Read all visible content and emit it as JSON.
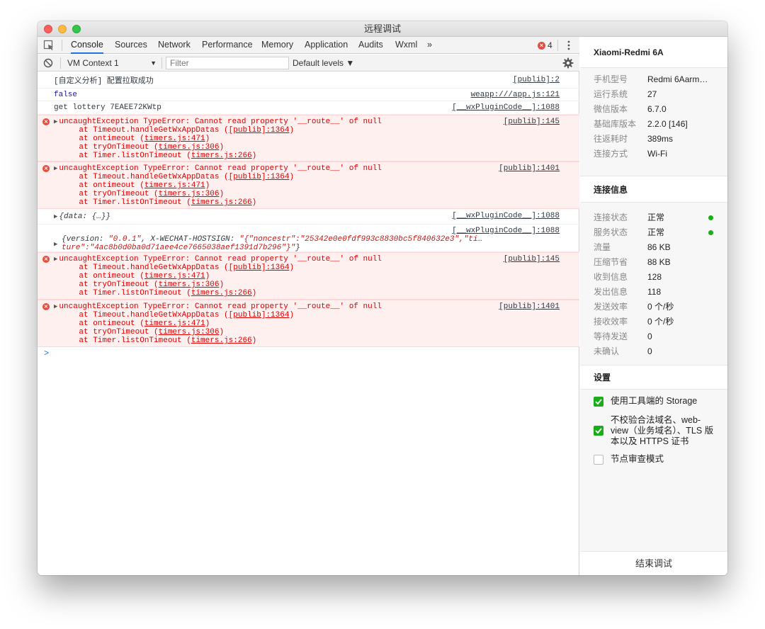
{
  "window": {
    "title": "远程调试"
  },
  "tabs": [
    {
      "label": "Console",
      "active": true
    },
    {
      "label": "Sources"
    },
    {
      "label": "Network"
    },
    {
      "label": "Performance"
    },
    {
      "label": "Memory"
    },
    {
      "label": "Application"
    },
    {
      "label": "Audits"
    },
    {
      "label": "Wxml"
    },
    {
      "label": "»"
    }
  ],
  "error_count": "4",
  "toolbar": {
    "context": "VM Context 1",
    "filter_placeholder": "Filter",
    "levels": "Default levels ▼"
  },
  "console": {
    "m1": {
      "text": "[自定义分析] 配置拉取成功",
      "src": "[publib]:2"
    },
    "m2": {
      "text": "false",
      "src": "weapp:///app.js:121"
    },
    "m3": {
      "text": "get lottery 7EAEE72KWtp",
      "src": "[__wxPluginCode__]:1088"
    },
    "e1": {
      "head": "uncaughtException TypeError: Cannot read property '__route__' of null",
      "src": "[publib]:145",
      "s1a": "    at Timeout.handleGetWxAppDatas (",
      "s1b": "[publib]:1364",
      "s1c": ")",
      "s2a": "    at ontimeout (",
      "s2b": "timers.js:471",
      "s2c": ")",
      "s3a": "    at tryOnTimeout (",
      "s3b": "timers.js:306",
      "s3c": ")",
      "s4a": "    at Timer.listOnTimeout (",
      "s4b": "timers.js:266",
      "s4c": ")"
    },
    "e2": {
      "head": "uncaughtException TypeError: Cannot read property '__route__' of null",
      "src": "[publib]:1401",
      "s1a": "    at Timeout.handleGetWxAppDatas (",
      "s1b": "[publib]:1364",
      "s1c": ")",
      "s2a": "    at ontimeout (",
      "s2b": "timers.js:471",
      "s2c": ")",
      "s3a": "    at tryOnTimeout (",
      "s3b": "timers.js:306",
      "s3c": ")",
      "s4a": "    at Timer.listOnTimeout (",
      "s4b": "timers.js:266",
      "s4c": ")"
    },
    "m4": {
      "text": "{data: {…}}",
      "src": "[__wxPluginCode__]:1088"
    },
    "m5": {
      "src": "[__wxPluginCode__]:1088",
      "l1a": "{version: ",
      "l1b": "\"0.0.1\"",
      "l1c": ", X-WECHAT-HOSTSIGN: ",
      "l1d": "\"{\"noncestr\":\"25342e0e0fdf993c8830bc5f840632e3\",\"ti…",
      "l2a": "ture\":\"4ac8b0d0ba0d71aee4ce7665038aef1391d7b296\"}\"",
      "l2b": "}"
    },
    "e3": {
      "head": "uncaughtException TypeError: Cannot read property '__route__' of null",
      "src": "[publib]:145",
      "s1a": "    at Timeout.handleGetWxAppDatas (",
      "s1b": "[publib]:1364",
      "s1c": ")",
      "s2a": "    at ontimeout (",
      "s2b": "timers.js:471",
      "s2c": ")",
      "s3a": "    at tryOnTimeout (",
      "s3b": "timers.js:306",
      "s3c": ")",
      "s4a": "    at Timer.listOnTimeout (",
      "s4b": "timers.js:266",
      "s4c": ")"
    },
    "e4": {
      "head": "uncaughtException TypeError: Cannot read property '__route__' of null",
      "src": "[publib]:1401",
      "s1a": "    at Timeout.handleGetWxAppDatas (",
      "s1b": "[publib]:1364",
      "s1c": ")",
      "s2a": "    at ontimeout (",
      "s2b": "timers.js:471",
      "s2c": ")",
      "s3a": "    at tryOnTimeout (",
      "s3b": "timers.js:306",
      "s3c": ")",
      "s4a": "    at Timer.listOnTimeout (",
      "s4b": "timers.js:266",
      "s4c": ")"
    },
    "prompt": ">"
  },
  "side": {
    "device": "Xiaomi-Redmi 6A",
    "info": [
      {
        "k": "手机型号",
        "v": "Redmi 6Aarme…"
      },
      {
        "k": "运行系统",
        "v": "27"
      },
      {
        "k": "微信版本",
        "v": "6.7.0"
      },
      {
        "k": "基础库版本",
        "v": "2.2.0 [146]"
      },
      {
        "k": "往返耗时",
        "v": "389ms"
      },
      {
        "k": "连接方式",
        "v": "Wi-Fi"
      }
    ],
    "conn_title": "连接信息",
    "conn": [
      {
        "k": "连接状态",
        "v": "正常"
      },
      {
        "k": "服务状态",
        "v": "正常"
      },
      {
        "k": "流量",
        "v": "86 KB"
      },
      {
        "k": "压缩节省",
        "v": "88 KB"
      },
      {
        "k": "收到信息",
        "v": "128"
      },
      {
        "k": "发出信息",
        "v": "118"
      },
      {
        "k": "发送效率",
        "v": "0 个/秒"
      },
      {
        "k": "接收效率",
        "v": "0 个/秒"
      },
      {
        "k": "等待发送",
        "v": "0"
      },
      {
        "k": "未确认",
        "v": "0"
      }
    ],
    "settings_title": "设置",
    "settings": [
      {
        "label": "使用工具端的 Storage",
        "checked": true
      },
      {
        "label": "不校验合法域名、web-view（业务域名）、TLS 版本以及 HTTPS 证书",
        "checked": true
      },
      {
        "label": "节点审查模式",
        "checked": false
      }
    ],
    "end_button": "结束调试"
  },
  "colors": {
    "accent": "#1a73e8",
    "error": "#e00000",
    "error_bg": "#fff0f0",
    "ok_green": "#1aad19"
  }
}
